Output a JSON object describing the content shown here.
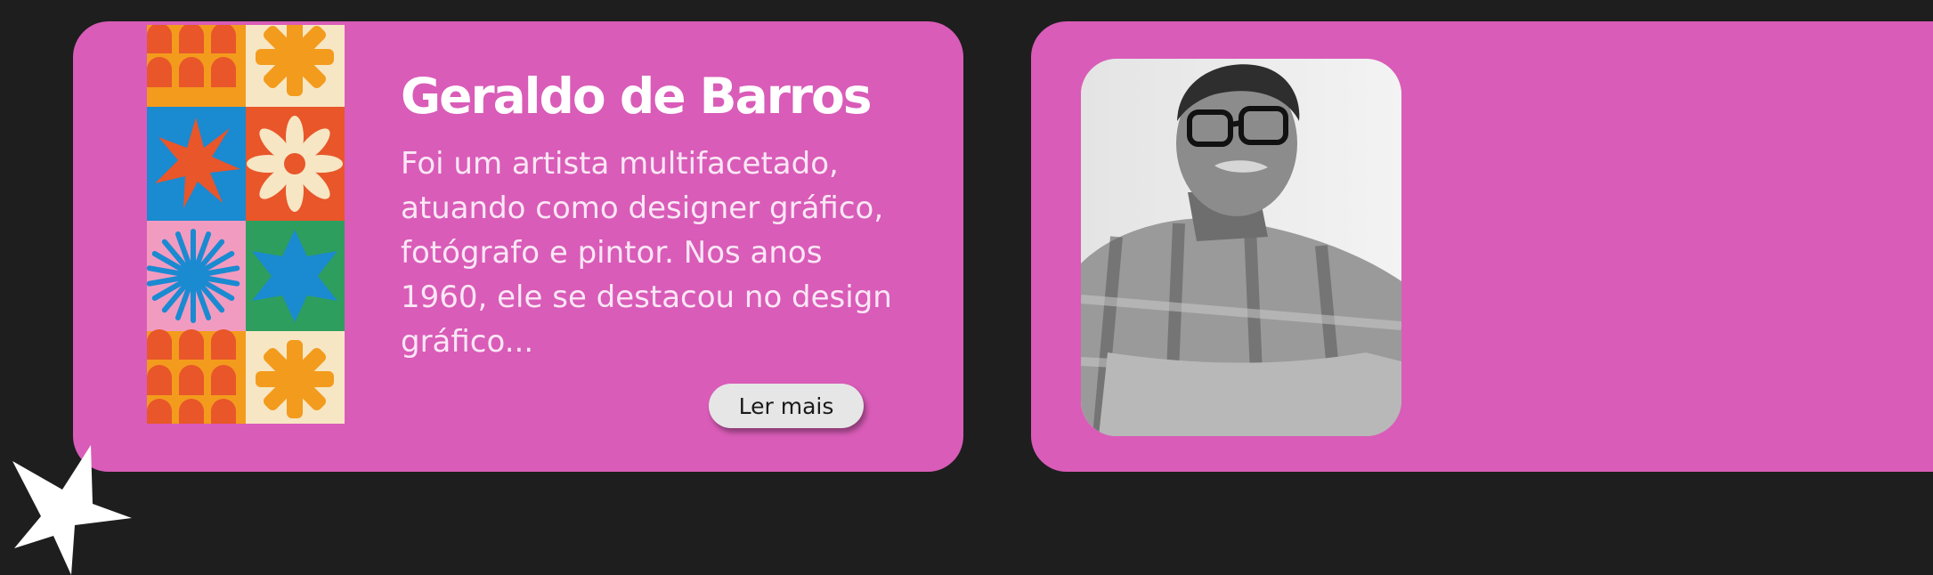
{
  "profile": {
    "name": "Geraldo de Barros",
    "description": "Foi um artista multifacetado, atuando como designer gráfico, fotógrafo e pintor. Nos anos 1960, ele se destacou no design gráfico...",
    "read_more_label": "Ler mais"
  },
  "colors": {
    "background": "#1e1e1e",
    "card": "#d95cb8",
    "button": "#e6e6e6"
  }
}
